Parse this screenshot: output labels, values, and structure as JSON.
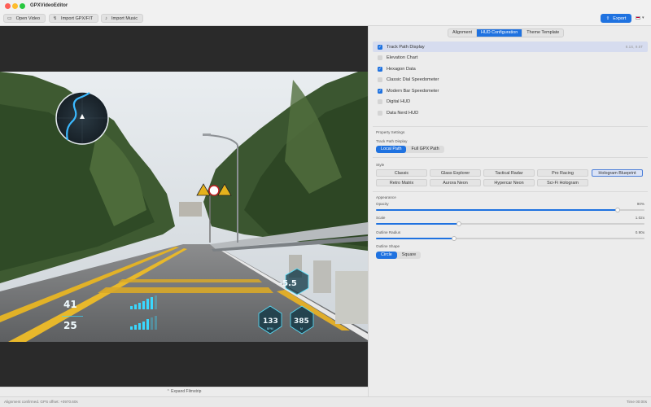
{
  "app": {
    "title": "GPXVideoEditor"
  },
  "toolbar": {
    "open_video": "Open Video",
    "import_gpx": "Import GPX/FIT",
    "import_music": "Import Music",
    "export": "Export"
  },
  "video": {
    "hud_speed_1": "41",
    "hud_speed_2": "25",
    "hud_grade": "-5.5",
    "hud_value_1": "133",
    "hud_value_1_unit": "BPM",
    "hud_value_2": "385",
    "hud_value_2_unit": "M",
    "expand_filmstrip": "Expand Filmstrip"
  },
  "tabs": [
    {
      "label": "Alignment",
      "active": false
    },
    {
      "label": "HUD Configuration",
      "active": true
    },
    {
      "label": "Theme Template",
      "active": false
    }
  ],
  "hud_elements": [
    {
      "label": "Track Path Display",
      "checked": true,
      "selected": true,
      "meta": "8.1S, 9.5T"
    },
    {
      "label": "Elevation Chart",
      "checked": false,
      "selected": false,
      "meta": ""
    },
    {
      "label": "Hexagon Data",
      "checked": true,
      "selected": false,
      "meta": ""
    },
    {
      "label": "Classic Dial Speedometer",
      "checked": false,
      "selected": false,
      "meta": ""
    },
    {
      "label": "Modern Bar Speedometer",
      "checked": true,
      "selected": false,
      "meta": ""
    },
    {
      "label": "Digital HUD",
      "checked": false,
      "selected": false,
      "meta": ""
    },
    {
      "label": "Data Nerd HUD",
      "checked": false,
      "selected": false,
      "meta": ""
    }
  ],
  "property_settings": {
    "header": "Property Settings",
    "track_path_label": "Track Path Display",
    "path_modes": [
      {
        "label": "Local Path",
        "active": true
      },
      {
        "label": "Full GPX Path",
        "active": false
      }
    ],
    "style_label": "Style",
    "styles": [
      {
        "label": "Classic",
        "active": false
      },
      {
        "label": "Glass Explorer",
        "active": false
      },
      {
        "label": "Tactical Radar",
        "active": false
      },
      {
        "label": "Pro Racing",
        "active": false
      },
      {
        "label": "Hologram Blueprint",
        "active": true
      },
      {
        "label": "Retro Matrix",
        "active": false
      },
      {
        "label": "Aurora Neon",
        "active": false
      },
      {
        "label": "Hypercar Neon",
        "active": false
      },
      {
        "label": "Sci-Fi Hologram",
        "active": false
      }
    ],
    "appearance_label": "Appearance",
    "sliders": [
      {
        "label": "Opacity",
        "value": "90%",
        "fraction": 0.9
      },
      {
        "label": "Scale",
        "value": "1.02x",
        "fraction": 0.31
      },
      {
        "label": "Outline Radius",
        "value": "0.90x",
        "fraction": 0.29
      }
    ],
    "outline_shape_label": "Outline Shape",
    "outline_shapes": [
      {
        "label": "Circle",
        "active": true
      },
      {
        "label": "Square",
        "active": false
      }
    ]
  },
  "status": {
    "left": "Alignment confirmed. GPS offset: +0970.60s",
    "right": "Time 00:00s"
  },
  "colors": {
    "accent": "#1f72e0",
    "hud_cyan": "#39d8ff"
  }
}
